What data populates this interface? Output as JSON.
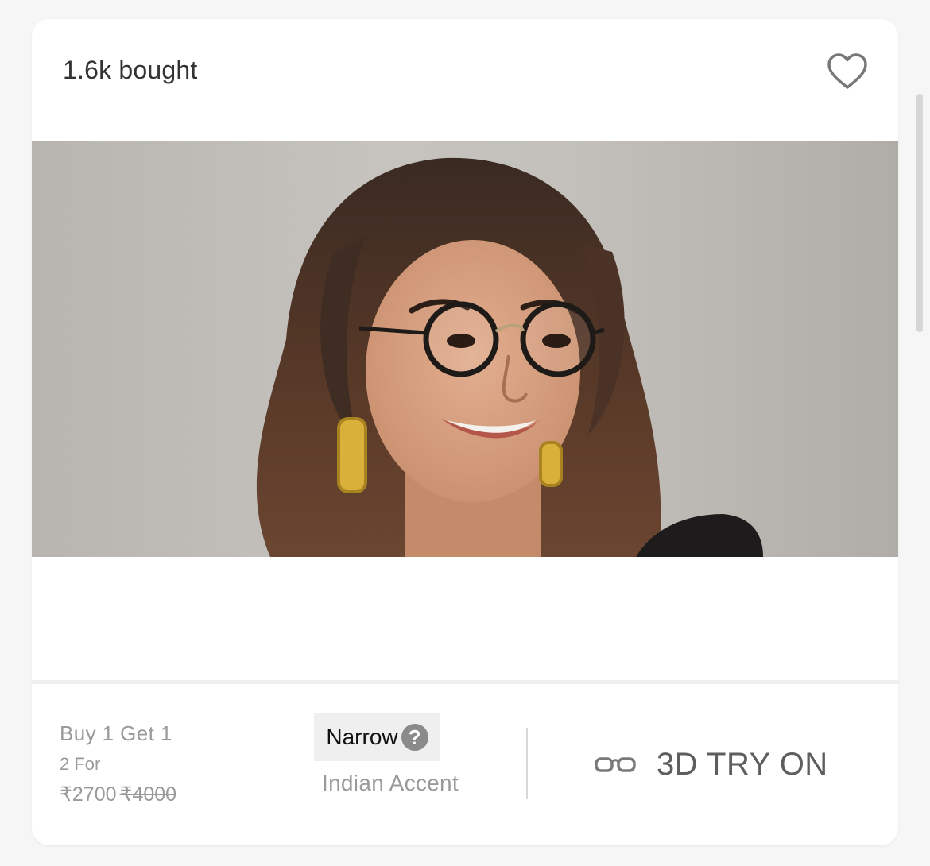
{
  "product": {
    "bought_count": "1.6k bought",
    "wishlist_icon": "heart-outline-icon"
  },
  "image": {
    "subject": "model-wearing-round-eyeglasses",
    "background_color": "#c2bfbb"
  },
  "offer": {
    "headline": "Buy 1 Get 1",
    "bundle": "2 For",
    "price": "₹2700",
    "original_price": "₹4000"
  },
  "fit": {
    "label": "Narrow",
    "help_icon": "question-mark-icon",
    "help_glyph": "?"
  },
  "brand": {
    "name": "Indian Accent"
  },
  "try_on": {
    "icon": "glasses-icon",
    "label": "3D TRY ON"
  },
  "colors": {
    "accent_text": "#5e5e5e",
    "muted_text": "#9a9a9a",
    "card_bg": "#ffffff",
    "page_bg": "#f6f6f6"
  }
}
